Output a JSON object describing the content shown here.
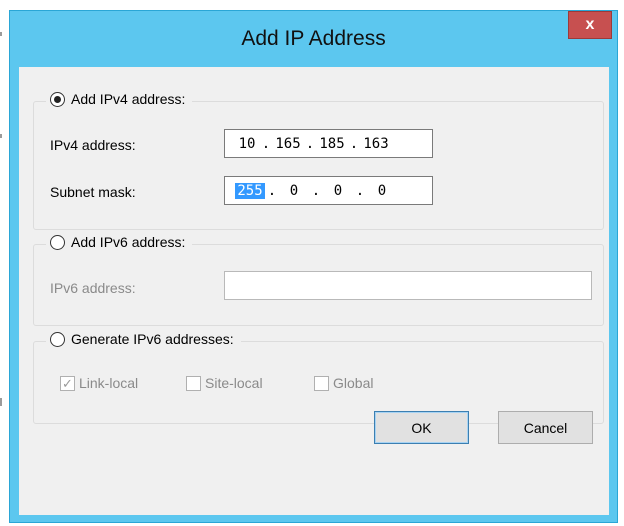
{
  "window": {
    "title": "Add IP Address",
    "close_icon": "close-icon",
    "accent_color": "#5cc7ef",
    "close_color": "#c75050"
  },
  "ipv4": {
    "radio_label": "Add IPv4 address:",
    "selected": true,
    "address_label": "IPv4 address:",
    "address_octets": [
      "10",
      "165",
      "185",
      "163"
    ],
    "mask_label": "Subnet mask:",
    "mask_octets": [
      "255",
      "0",
      "0",
      "0"
    ],
    "mask_selected_octet": "255"
  },
  "ipv6": {
    "radio_label": "Add IPv6 address:",
    "selected": false,
    "address_label": "IPv6 address:",
    "address_value": ""
  },
  "generate": {
    "radio_label": "Generate IPv6 addresses:",
    "selected": false,
    "options": [
      {
        "label": "Link-local",
        "checked": true
      },
      {
        "label": "Site-local",
        "checked": false
      },
      {
        "label": "Global",
        "checked": false
      }
    ]
  },
  "buttons": {
    "ok": "OK",
    "cancel": "Cancel"
  }
}
